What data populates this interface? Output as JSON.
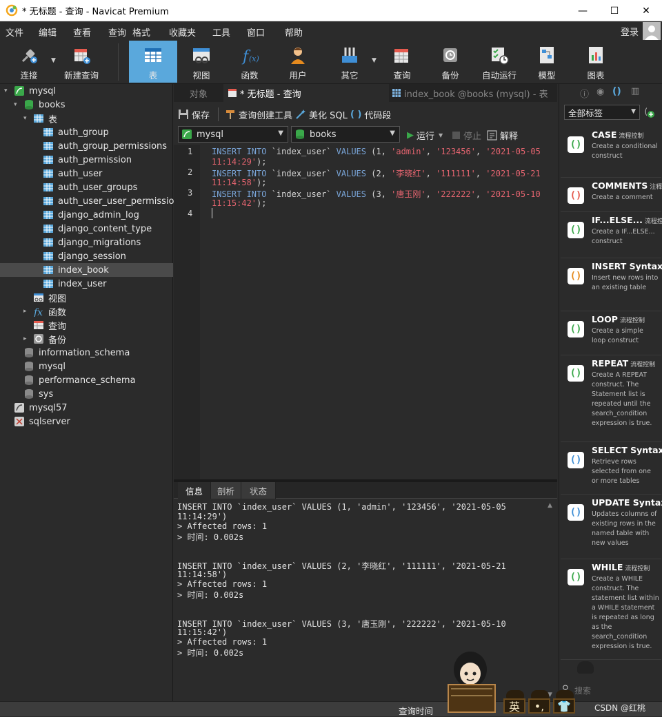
{
  "window": {
    "title": "* 无标题 - 查询 - Navicat Premium",
    "controls": [
      "—",
      "☐",
      "✕"
    ]
  },
  "menu": {
    "items": [
      "文件",
      "编辑",
      "查看",
      "查询",
      "格式",
      "收藏夹",
      "工具",
      "窗口",
      "帮助"
    ],
    "login": "登录"
  },
  "toolbar": {
    "buttons": [
      {
        "label": "连接",
        "icon": "plug-icon"
      },
      {
        "label": "新建查询",
        "icon": "new-query-icon"
      },
      {
        "label": "表",
        "icon": "table-icon",
        "active": true
      },
      {
        "label": "视图",
        "icon": "view-icon"
      },
      {
        "label": "函数",
        "icon": "function-icon"
      },
      {
        "label": "用户",
        "icon": "user-icon"
      },
      {
        "label": "其它",
        "icon": "tools-icon"
      },
      {
        "label": "查询",
        "icon": "query-icon"
      },
      {
        "label": "备份",
        "icon": "backup-icon"
      },
      {
        "label": "自动运行",
        "icon": "schedule-icon"
      },
      {
        "label": "模型",
        "icon": "model-icon"
      },
      {
        "label": "图表",
        "icon": "chart-icon"
      }
    ]
  },
  "tree": {
    "items": [
      {
        "label": "mysql",
        "icon": "mysql-connection-icon"
      },
      {
        "label": "books",
        "icon": "database-icon"
      },
      {
        "label": "表",
        "icon": "tables-folder-icon"
      },
      {
        "label": "auth_group",
        "icon": "table-icon"
      },
      {
        "label": "auth_group_permissions",
        "icon": "table-icon"
      },
      {
        "label": "auth_permission",
        "icon": "table-icon"
      },
      {
        "label": "auth_user",
        "icon": "table-icon"
      },
      {
        "label": "auth_user_groups",
        "icon": "table-icon"
      },
      {
        "label": "auth_user_user_permissions",
        "icon": "table-icon"
      },
      {
        "label": "django_admin_log",
        "icon": "table-icon"
      },
      {
        "label": "django_content_type",
        "icon": "table-icon"
      },
      {
        "label": "django_migrations",
        "icon": "table-icon"
      },
      {
        "label": "django_session",
        "icon": "table-icon"
      },
      {
        "label": "index_book",
        "icon": "table-icon",
        "selected": true
      },
      {
        "label": "index_user",
        "icon": "table-icon"
      },
      {
        "label": "视图",
        "icon": "views-folder-icon"
      },
      {
        "label": "函数",
        "icon": "functions-folder-icon"
      },
      {
        "label": "查询",
        "icon": "queries-folder-icon"
      },
      {
        "label": "备份",
        "icon": "backups-folder-icon"
      },
      {
        "label": "information_schema",
        "icon": "database-gray-icon"
      },
      {
        "label": "mysql",
        "icon": "database-gray-icon"
      },
      {
        "label": "performance_schema",
        "icon": "database-gray-icon"
      },
      {
        "label": "sys",
        "icon": "database-gray-icon"
      },
      {
        "label": "mysql57",
        "icon": "mysql-connection-gray-icon"
      },
      {
        "label": "sqlserver",
        "icon": "sqlserver-connection-icon"
      }
    ]
  },
  "tabs": {
    "objects": "对象",
    "query": "* 无标题 - 查询",
    "table": "index_book @books (mysql) - 表"
  },
  "editor_toolbar": {
    "save": "保存",
    "builder": "查询创建工具",
    "beautify": "美化 SQL",
    "snippet": "代码段"
  },
  "selectors": {
    "connection": "mysql",
    "database": "books",
    "run": "运行",
    "stop": "停止",
    "explain": "解释"
  },
  "code": {
    "line_numbers": [
      "1",
      "2",
      "3",
      "4"
    ],
    "lines": [
      {
        "kw1": "INSERT INTO",
        "tbl": " `index_user` ",
        "kw2": "VALUES",
        "p1": " (1, ",
        "s1": "'admin'",
        "c1": ", ",
        "s2": "'123456'",
        "c2": ", ",
        "s3": "'2021-05-05",
        "cont": "11:14:29'",
        "end": ");"
      },
      {
        "kw1": "INSERT INTO",
        "tbl": " `index_user` ",
        "kw2": "VALUES",
        "p1": " (2, ",
        "s1": "'李晓红'",
        "c1": ", ",
        "s2": "'111111'",
        "c2": ", ",
        "s3": "'2021-05-21",
        "cont": "11:14:58'",
        "end": ");"
      },
      {
        "kw1": "INSERT INTO",
        "tbl": " `index_user` ",
        "kw2": "VALUES",
        "p1": " (3, ",
        "s1": "'唐玉刚'",
        "c1": ", ",
        "s2": "'222222'",
        "c2": ", ",
        "s3": "'2021-05-10",
        "cont": "11:15:42'",
        "end": ");"
      }
    ]
  },
  "result_tabs": [
    "信息",
    "剖析",
    "状态"
  ],
  "results": [
    {
      "stmt1": "INSERT INTO `index_user` VALUES (1, 'admin', '123456', '2021-05-05",
      "stmt2": "11:14:29')",
      "affected": "> Affected rows: 1",
      "time": "> 时间: 0.002s"
    },
    {
      "stmt1": "INSERT INTO `index_user` VALUES (2, '李晓红', '111111', '2021-05-21",
      "stmt2": "11:14:58')",
      "affected": "> Affected rows: 1",
      "time": "> 时间: 0.002s"
    },
    {
      "stmt1": "INSERT INTO `index_user` VALUES (3, '唐玉刚', '222222', '2021-05-10",
      "stmt2": "11:15:42')",
      "affected": "> Affected rows: 1",
      "time": "> 时间: 0.002s"
    }
  ],
  "snippets": {
    "filter": "全部标签",
    "search_placeholder": "搜索",
    "items": [
      {
        "name": "CASE",
        "tag": "流程控制",
        "desc": "Create a conditional construct"
      },
      {
        "name": "COMMENTS",
        "tag": "注释",
        "desc": "Create a comment"
      },
      {
        "name": "IF...ELSE...",
        "tag": "流程控制",
        "desc": "Create a IF...ELSE... construct"
      },
      {
        "name": "INSERT Syntax",
        "tag": "DML",
        "desc": "Insert new rows into an existing table"
      },
      {
        "name": "LOOP",
        "tag": "流程控制",
        "desc": "Create a simple loop construct"
      },
      {
        "name": "REPEAT",
        "tag": "流程控制",
        "desc": "Create A REPEAT construct. The Statement list is repeated until the search_condition expression is true."
      },
      {
        "name": "SELECT Syntax",
        "tag": "DML",
        "desc": "Retrieve rows selected from one or more tables"
      },
      {
        "name": "UPDATE Syntax",
        "tag": "",
        "desc": "Updates columns of existing rows in the named table with new values"
      },
      {
        "name": "WHILE",
        "tag": "流程控制",
        "desc": "Create a WHILE construct. The statement list within a WHILE statement is repeated as long as the search_condition expression is true."
      }
    ]
  },
  "status": {
    "query_time": "查询时间",
    "watermark": "CSDN @红桃"
  },
  "ime": {
    "mode": "英"
  },
  "colors": {
    "accent": "#5aa8dc",
    "keyword": "#7aa6da",
    "string": "#e4646f",
    "background": "#2b2b2b"
  }
}
